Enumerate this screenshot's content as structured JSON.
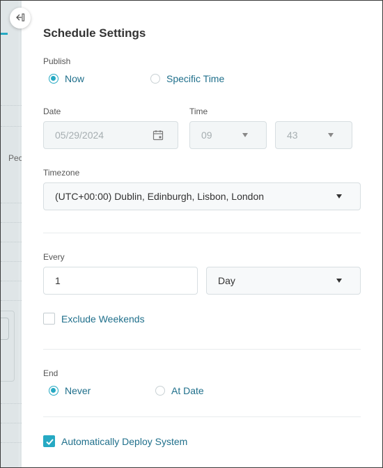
{
  "panel": {
    "title": "Schedule Settings",
    "collapse_icon": "collapse-left-icon"
  },
  "background": {
    "partial_text": "Pec"
  },
  "publish": {
    "label": "Publish",
    "options": [
      {
        "label": "Now",
        "selected": true
      },
      {
        "label": "Specific Time",
        "selected": false
      }
    ]
  },
  "date": {
    "label": "Date",
    "value": "05/29/2024",
    "icon": "calendar-icon",
    "disabled": true
  },
  "time": {
    "label": "Time",
    "hour": "09",
    "minute": "43",
    "disabled": true
  },
  "timezone": {
    "label": "Timezone",
    "value": "(UTC+00:00) Dublin, Edinburgh, Lisbon, London"
  },
  "every": {
    "label": "Every",
    "count": "1",
    "unit": "Day"
  },
  "exclude_weekends": {
    "label": "Exclude Weekends",
    "checked": false
  },
  "end": {
    "label": "End",
    "options": [
      {
        "label": "Never",
        "selected": true
      },
      {
        "label": "At Date",
        "selected": false
      }
    ]
  },
  "auto_deploy": {
    "label": "Automatically Deploy System",
    "checked": true
  },
  "colors": {
    "accent": "#26a9c3",
    "link_text": "#1f6f8b",
    "disabled_bg": "#f3f6f7"
  }
}
